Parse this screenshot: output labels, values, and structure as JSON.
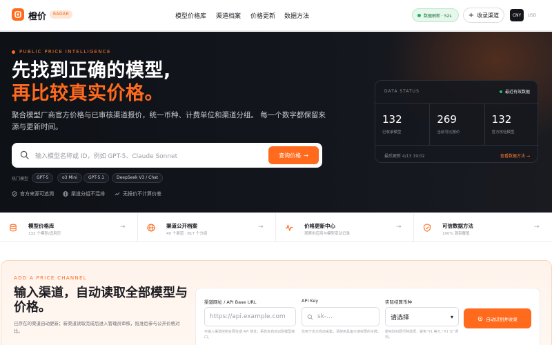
{
  "nav": {
    "brand": "橙价",
    "badge": "RADAR",
    "links": [
      "模型价格库",
      "渠道档案",
      "价格更新",
      "数据方法"
    ],
    "live": "数据刷新 · 52s",
    "add_channel": "收录渠道",
    "currency_active": "CNY",
    "currency_other": "USD"
  },
  "hero": {
    "eyebrow": "PUBLIC PRICE INTELLIGENCE",
    "title_line1": "先找到正确的模型,",
    "title_line2": "再比较真实价格。",
    "subtitle": "聚合模型厂商官方价格与已审核渠道报价，统一币种、计费单位和渠道分组。 每一个数字都保留来源与更新时间。",
    "search_placeholder": "输入模型名称或 ID，例如 GPT-5、Claude Sonnet",
    "search_button": "查询价格",
    "hot_label": "热门模型",
    "hot_models": [
      "GPT-5",
      "o3 Mini",
      "GPT-5.1",
      "DeepSeek V3 / Chat"
    ],
    "features": [
      "官方来源可追溯",
      "渠道分组不混排",
      "无报价不计算价差"
    ]
  },
  "status": {
    "title": "DATA STATUS",
    "badge": "最近有效数据",
    "stats": [
      {
        "value": "132",
        "label": "已收录模型"
      },
      {
        "value": "269",
        "label": "当前可比报价"
      },
      {
        "value": "132",
        "label": "官方核验模型"
      }
    ],
    "updated": "最后更新 4/13 19:02",
    "method_link": "查看数据方法"
  },
  "strip": [
    {
      "title": "模型价格库",
      "desc": "132 个模型/适用页"
    },
    {
      "title": "渠道公开档案",
      "desc": "40 个渠道 · 817 个分组"
    },
    {
      "title": "价格更新中心",
      "desc": "观察供应商与模型变动记录"
    },
    {
      "title": "可信数据方法",
      "desc": "100% 源审覆盖"
    }
  ],
  "channel": {
    "eyebrow": "ADD A PRICE CHANNEL",
    "title": "输入渠道，自动读取全部模型与价格。",
    "desc": "已存在的渠道自动更新；新渠道读取完成后进入管理员审核，批准后参与公开价格对比。",
    "url_label": "渠道网址 / API Base URL",
    "url_placeholder": "https://api.example.com",
    "url_hint": "可输入渠道控制台网址或 API 地址，系统会自动识别模型接口。",
    "key_label": "API Key",
    "key_placeholder": "sk-...",
    "key_hint": "仅用于本次自动采集，请使用具备只读权限的令牌。",
    "currency_label": "实际结算币种",
    "currency_value": "请选择",
    "currency_hint": "按实际扣费币种选择，避免“¥1 美元 / ¥1 元”误判。",
    "submit": "自动识别并收录"
  }
}
